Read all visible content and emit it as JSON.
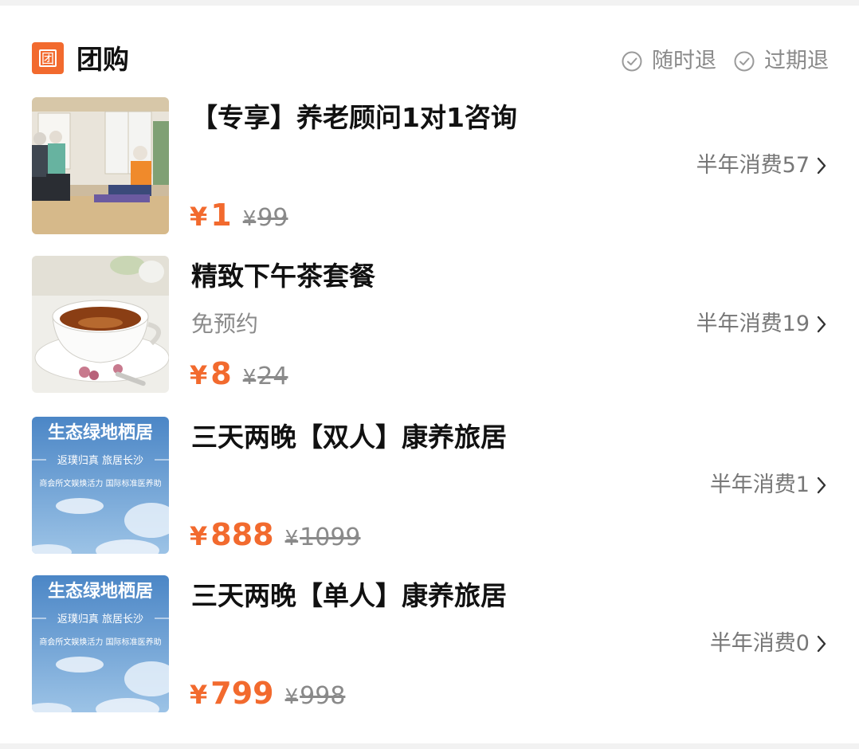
{
  "header": {
    "icon_char": "团",
    "title": "团购",
    "badges": [
      "随时退",
      "过期退"
    ]
  },
  "currency_symbol": "¥",
  "items": [
    {
      "title": "【专享】养老顾问1对1咨询",
      "subtitle": "",
      "sales": "半年消费57",
      "price": "1",
      "original_price": "99"
    },
    {
      "title": "精致下午茶套餐",
      "subtitle": "免预约",
      "sales": "半年消费19",
      "price": "8",
      "original_price": "24"
    },
    {
      "title": "三天两晚【双人】康养旅居",
      "subtitle": "",
      "sales": "半年消费1",
      "price": "888",
      "original_price": "1099",
      "thumb_text": {
        "headline": "生态绿地栖居",
        "line1": "返璞归真 旅居长沙",
        "line2": "商会所文娱焕活力 国际标准医养助"
      }
    },
    {
      "title": "三天两晚【单人】康养旅居",
      "subtitle": "",
      "sales": "半年消费0",
      "price": "799",
      "original_price": "998",
      "thumb_text": {
        "headline": "生态绿地栖居",
        "line1": "返璞归真 旅居长沙",
        "line2": "商会所文娱焕活力 国际标准医养助"
      }
    }
  ],
  "colors": {
    "accent": "#f26a2e",
    "muted": "#8a8a8a",
    "title": "#111111"
  }
}
